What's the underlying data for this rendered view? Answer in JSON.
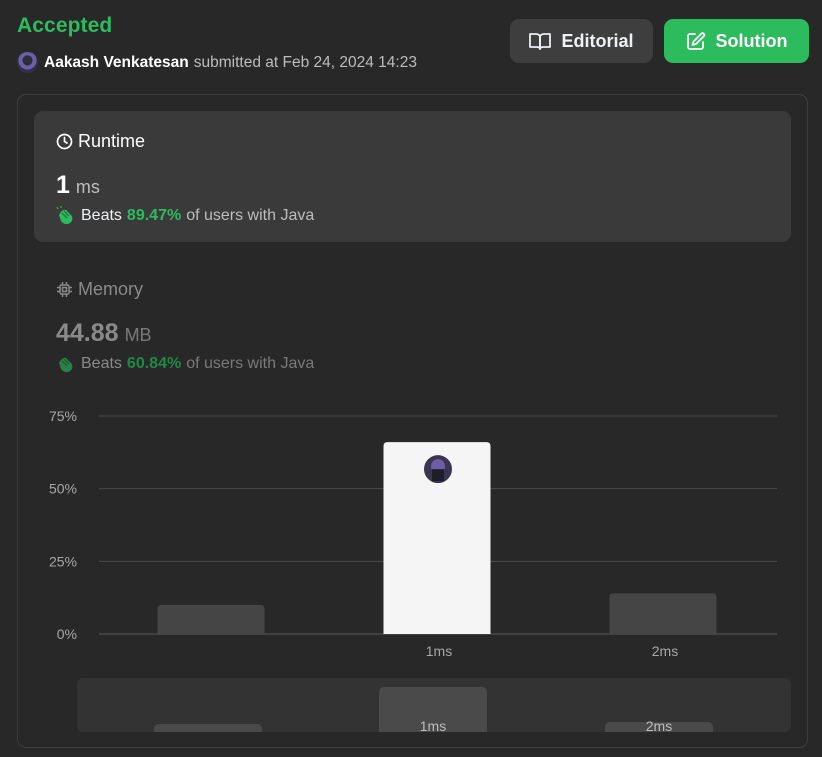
{
  "header": {
    "status": "Accepted",
    "user_name": "Aakash Venkatesan",
    "submitted_text": "submitted at Feb 24, 2024 14:23",
    "editorial_label": "Editorial",
    "solution_label": "Solution"
  },
  "runtime": {
    "title": "Runtime",
    "value": "1",
    "unit": "ms",
    "beats_word": "Beats",
    "beats_pct": "89.47%",
    "beats_suffix": "of users with Java"
  },
  "memory": {
    "title": "Memory",
    "value": "44.88",
    "unit": "MB",
    "beats_word": "Beats",
    "beats_pct": "60.84%",
    "beats_suffix": "of users with Java"
  },
  "navigator": {
    "labels": [
      "1ms",
      "2ms"
    ]
  },
  "colors": {
    "accent_green": "#2cbb5d",
    "background": "#282828",
    "card": "#3a3a3a",
    "bar": "#454545",
    "bar_selected": "#f5f5f5"
  },
  "chart_data": {
    "type": "bar",
    "categories": [
      "",
      "1ms",
      "2ms"
    ],
    "values": [
      10,
      66,
      14
    ],
    "highlighted_category": "1ms",
    "y_ticks": [
      "0%",
      "25%",
      "50%",
      "75%"
    ],
    "ylim": [
      0,
      75
    ],
    "grid": true
  }
}
